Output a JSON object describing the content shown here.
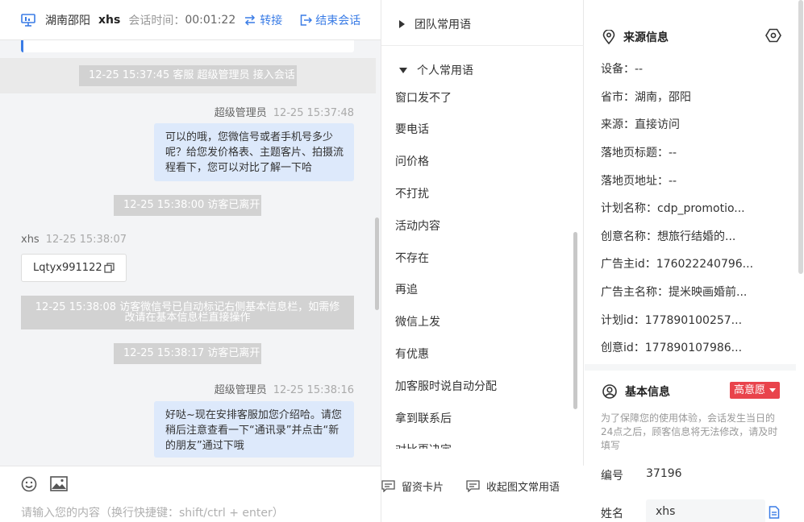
{
  "header": {
    "location": "湖南邵阳",
    "user": "xhs",
    "session_time_label": "会话时间：",
    "session_time": "00:01:22",
    "transfer_label": "转接",
    "end_label": "结束会话"
  },
  "chat": {
    "items": {
      "sys1": "12-25 15:37:45 客服 超级管理员 接入会话",
      "agent1_name": "超级管理员",
      "agent1_time": "12-25 15:37:48",
      "agent1_text": "可以的哦，您微信号或者手机号多少呢？给您发价格表、主题客片、拍摄流程看下，您可以对比了解一下哈",
      "sys2": "12-25 15:38:00 访客已离开",
      "visitor_name": "xhs",
      "visitor_time": "12-25 15:38:07",
      "visitor_text": "Lqtyx991122",
      "sys3": "12-25 15:38:08 访客微信号已自动标记右侧基本信息栏，如需修改请在基本信息栏直接操作",
      "sys4": "12-25 15:38:17 访客已离开",
      "agent2_name": "超级管理员",
      "agent2_time": "12-25 15:38:16",
      "agent2_text": "好哒~现在安排客服加您介绍哈。请您稍后注意查看一下“通讯录”并点击“新的朋友”通过下哦"
    },
    "input_placeholder": "请输入您的内容（换行快捷键：shift/ctrl + enter）"
  },
  "phrases": {
    "team_group": "团队常用语",
    "personal_group": "个人常用语",
    "list": [
      "窗口发不了",
      "要电话",
      "问价格",
      "不打扰",
      "活动内容",
      "不存在",
      "再追",
      "微信上发",
      "有优惠",
      "加客服时说自动分配",
      "拿到联系后",
      "对比再决定"
    ],
    "footer_card": "留资卡片",
    "footer_collapse": "收起图文常用语"
  },
  "info": {
    "source_title": "来源信息",
    "source_rows": [
      "设备：--",
      "省市：湖南，邵阳",
      "来源：直接访问",
      "落地页标题：--",
      "落地页地址：--",
      "计划名称：cdp_promotio...",
      "创意名称：想旅行结婚的...",
      "广告主id：176022240796...",
      "广告主名称：提米映画婚前...",
      "计划id：177890100257...",
      "创意id：177890107986..."
    ],
    "basic_title": "基本信息",
    "intent_badge": "高意愿",
    "notice": "为了保障您的使用体验，会话发生当日的24点之后，顾客信息将无法修改，请及时填写",
    "id_label": "编号",
    "id_value": "37196",
    "name_label": "姓名",
    "name_value": "xhs"
  },
  "colors": {
    "accent": "#3a7ce6",
    "agent_bubble": "#dde9fb",
    "badge": "#e9434b"
  }
}
